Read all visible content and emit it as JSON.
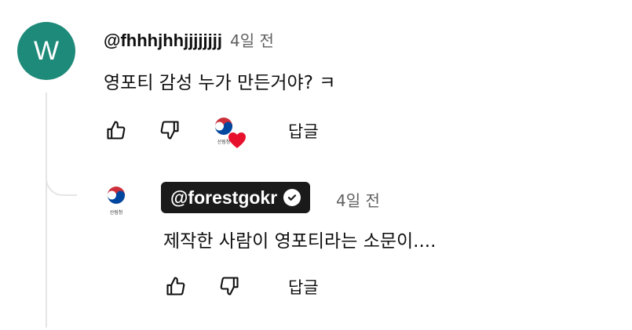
{
  "comment": {
    "avatar_letter": "W",
    "author": "@fhhhjhhjjjjjjjj",
    "time": "4일 전",
    "text": "영포티 감성 누가 만든거야? ㅋ",
    "reply_label": "답글",
    "creator_logo_caption": "산림청"
  },
  "reply": {
    "author": "@forestgokr",
    "time": "4일 전",
    "text": "제작한 사람이 영포티라는 소문이....",
    "reply_label": "답글",
    "logo_caption": "산림청"
  },
  "colors": {
    "avatar_bg": "#1e8a7a",
    "heart": "#e8112d",
    "badge_bg": "#1a1a1a",
    "muted": "#606060"
  }
}
